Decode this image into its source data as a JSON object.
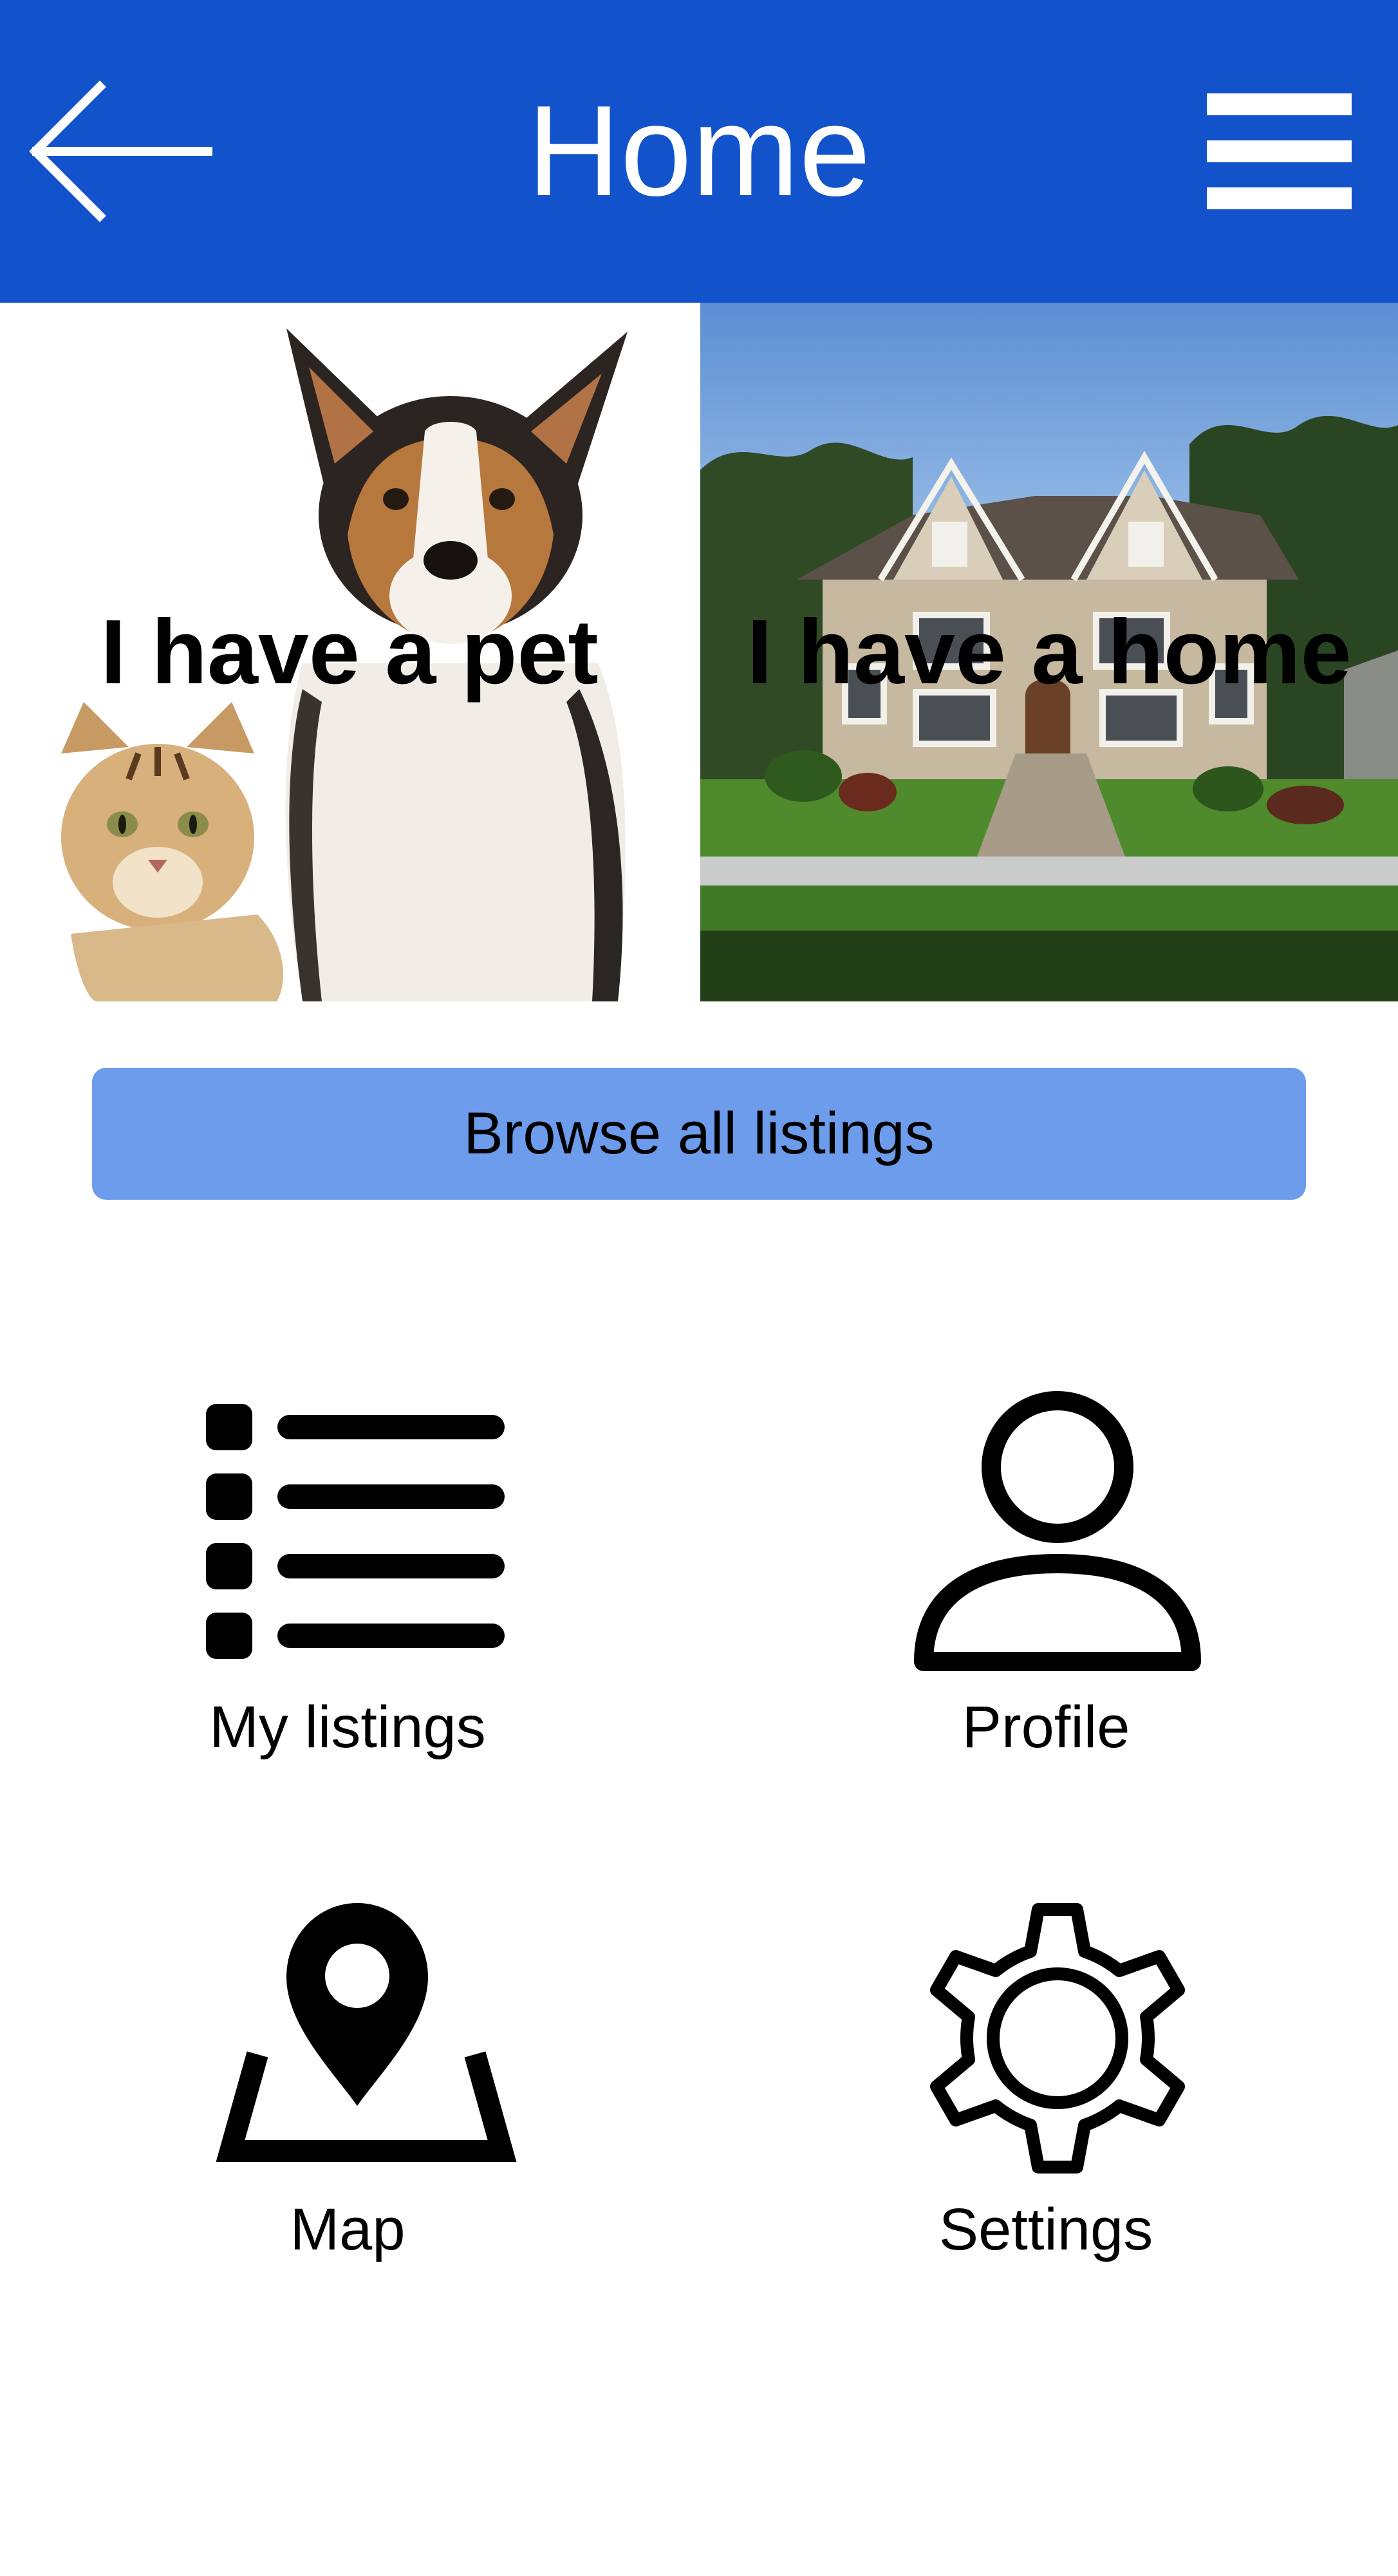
{
  "header": {
    "title": "Home",
    "back_icon": "back-arrow-icon",
    "menu_icon": "hamburger-menu-icon",
    "background_color": "#1253cb"
  },
  "tiles": [
    {
      "label": "I have a pet"
    },
    {
      "label": "I have a home"
    }
  ],
  "browse": {
    "label": "Browse all listings",
    "color": "#6c9ceb"
  },
  "nav": [
    {
      "label": "My listings",
      "icon": "list-icon"
    },
    {
      "label": "Profile",
      "icon": "user-icon"
    },
    {
      "label": "Map",
      "icon": "map-pin-icon"
    },
    {
      "label": "Settings",
      "icon": "gear-icon"
    }
  ]
}
